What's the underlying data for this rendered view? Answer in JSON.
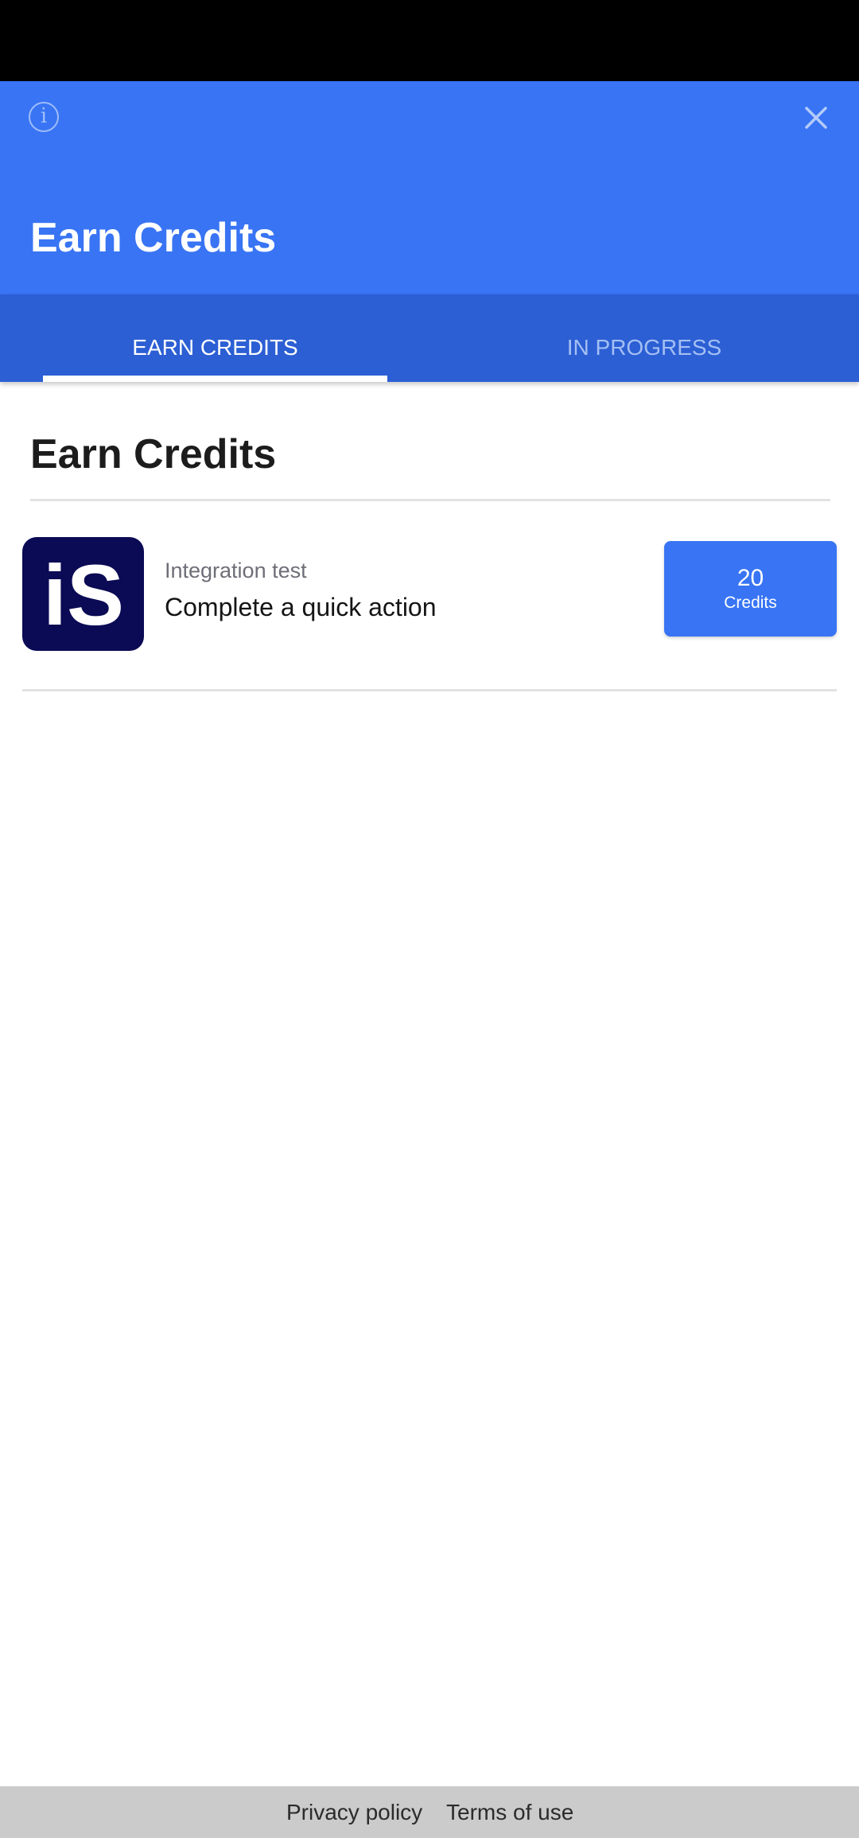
{
  "header": {
    "title": "Earn Credits",
    "info_icon_glyph": "i",
    "info_icon": "info-circle-icon",
    "close_icon": "close-icon",
    "background_color": "#3874f4"
  },
  "tabs": [
    {
      "label": "EARN CREDITS",
      "selected": true
    },
    {
      "label": "IN PROGRESS",
      "selected": false
    }
  ],
  "section": {
    "title": "Earn Credits"
  },
  "offers": [
    {
      "logo": "iS",
      "subtitle": "Integration test",
      "title": "Complete a quick action",
      "credits_value": "20",
      "credits_unit": "Credits"
    }
  ],
  "footer": {
    "privacy_label": "Privacy policy",
    "terms_label": "Terms of use"
  },
  "colors": {
    "accent": "#3874f4",
    "tab_bar": "#2c5fd4",
    "logo_background": "#0b0a55"
  }
}
